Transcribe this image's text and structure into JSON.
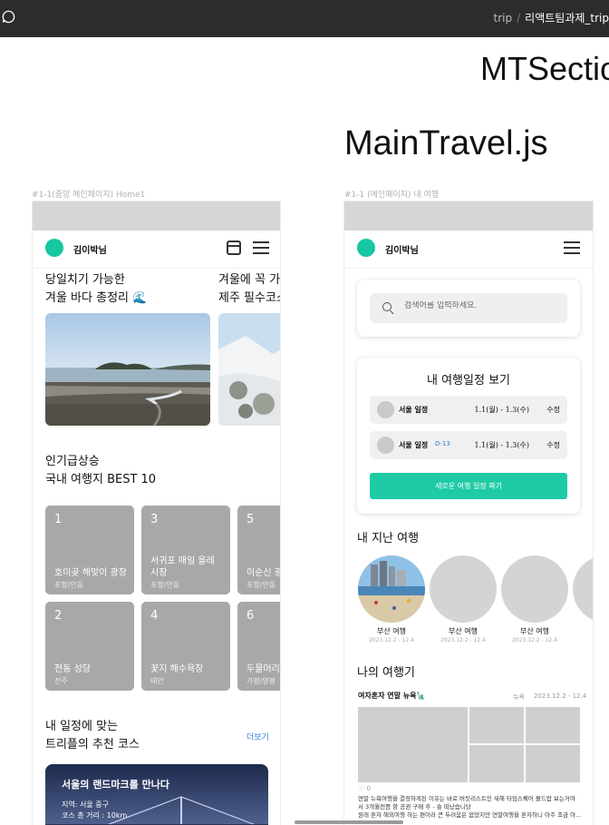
{
  "topbar": {
    "crumb_parent": "trip",
    "crumb_separator": "/",
    "crumb_current": "리액트팀과제_trip"
  },
  "canvas": {
    "section_title": "MTSectio",
    "file_title": "MainTravel.js"
  },
  "frames": {
    "home": {
      "label": "#1-1(중앙 메인페이지) Home1",
      "user_name": "김이박님",
      "banners": [
        {
          "line1": "당일치기 가능한",
          "line2": "겨울 바다 총정리 🌊"
        },
        {
          "line1": "겨울에 꼭 가야",
          "line2": "제주 필수코스"
        }
      ],
      "popular_title_1": "인기급상승",
      "popular_title_2": "국내 여행지 BEST 10",
      "tiles": [
        {
          "rank": "1",
          "name": "호미곶 해맞이 광장",
          "sub": "포항/안동"
        },
        {
          "rank": "3",
          "name": "서귀포 매일 올레\n시장",
          "sub": "포항/안동"
        },
        {
          "rank": "5",
          "name": "이순신 광장",
          "sub": "포항/안동"
        },
        {
          "rank": "2",
          "name": "전동 성당",
          "sub": "전주"
        },
        {
          "rank": "4",
          "name": "꽃지 해수욕장",
          "sub": "태안"
        },
        {
          "rank": "6",
          "name": "두물머리",
          "sub": "가평/양평"
        }
      ],
      "rec_title_1": "내 일정에 맞는",
      "rec_title_2": "트리플의 추천 코스",
      "more": "더보기",
      "rec_card": {
        "title": "서울의 랜드마크를 만나다",
        "region": "지역: 서울 중구",
        "distance": "코스 총 거리 : 10km"
      }
    },
    "travel": {
      "label": "#1-1 (메인페이지) 내 여행",
      "user_name": "김이박님",
      "search_placeholder": "검색어를 입력하세요.",
      "schedule_title": "내 여행일정 보기",
      "schedules": [
        {
          "name": "서울 일정",
          "dday": "",
          "date": "1.1(월) - 1.3(수)",
          "edit": "수정"
        },
        {
          "name": "서울 일정",
          "dday": "D-13",
          "date": "1.1(월) - 1.3(수)",
          "edit": "수정"
        }
      ],
      "new_button": "새로운 여행 일정 짜기",
      "past_title": "내 지난 여행",
      "past_trips": [
        {
          "name": "부산 여행",
          "date": "2023.12.2 - 12.4"
        },
        {
          "name": "부산 여행",
          "date": "2023.12.2 - 12.4"
        },
        {
          "name": "부산 여행",
          "date": "2023.12.2 - 12.4"
        },
        {
          "name": "부",
          "date": "202"
        }
      ],
      "journal_title": "나의 여행기",
      "journal": {
        "heading": "여자혼자 연말 뉴욕🗽",
        "tag": "뉴욕",
        "date": "2023.12.2 - 12.4",
        "likes": "♡ 0",
        "text_line1": "연말 뉴욕여행을 결정하게된 이유는 바로 버킷리스트인 새해 타임스퀘어 볼드랍 보는거여",
        "text_line2": "서 3개월전쯤 항 공권 구매 후 - 숑 떠났습니당",
        "text_line3": "원래 혼자 해외여행 하는 편이라 큰 두려움은 없었지만 연말여행을 혼자하니 아주 조금 아..."
      }
    }
  },
  "colors": {
    "accent": "#1ecba5",
    "topbar": "#2c2c2c",
    "tile": "#a8a8a8",
    "link": "#2f7fd6"
  }
}
